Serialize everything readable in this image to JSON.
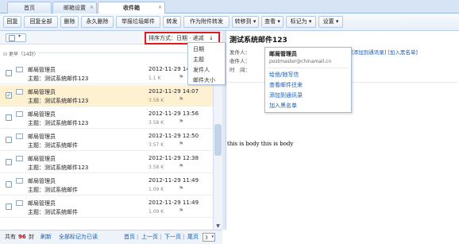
{
  "tabs": [
    {
      "label": "首页"
    },
    {
      "label": "邮箱设置"
    },
    {
      "label": "收件箱"
    }
  ],
  "toolbar": {
    "reply": "回复",
    "reply_all": "回复全部",
    "delete": "删除",
    "perm_delete": "永久删除",
    "report_spam": "举报垃圾邮件",
    "forward": "转发",
    "forward_attach": "作为附件转发",
    "move_to": "转移到",
    "view": "查看",
    "mark_as": "标记为",
    "settings": "设置"
  },
  "sort": {
    "label": "排序方式：日期 · 递减",
    "arrow": "↓",
    "options": [
      "日期",
      "主题",
      "发件人",
      "邮件大小"
    ]
  },
  "list": {
    "group_label": "更早（14封）",
    "messages": [
      {
        "from": "邮局管理员",
        "subject": "主题：测试系统邮件123",
        "date": "2012-11-29 14:07",
        "size": "1.1 K",
        "selected": false
      },
      {
        "from": "邮局管理员",
        "subject": "主题：测试系统邮件123",
        "date": "2012-11-29 14:07",
        "size": "3.58 K",
        "selected": true
      },
      {
        "from": "邮局管理员",
        "subject": "主题：测试系统邮件123",
        "date": "2012-11-29 13:56",
        "size": "3.58 K",
        "selected": false
      },
      {
        "from": "邮局管理员",
        "subject": "主题：测试系统邮件",
        "date": "2012-11-29 12:50",
        "size": "3.57 K",
        "selected": false
      },
      {
        "from": "邮局管理员",
        "subject": "主题：测试系统邮件123",
        "date": "2012-11-29 12:38",
        "size": "3.58 K",
        "selected": false
      },
      {
        "from": "邮局管理员",
        "subject": "主题：测试系统邮件",
        "date": "2012-11-29 11:49",
        "size": "1.09 K",
        "selected": false
      },
      {
        "from": "邮局管理员",
        "subject": "主题：测试系统邮件",
        "date": "2012-11-29 11:49",
        "size": "1.09 K",
        "selected": false
      }
    ]
  },
  "footer": {
    "total_prefix": "共有",
    "total_count": "96",
    "total_suffix": "封",
    "refresh": "刷新",
    "mark_all_read": "全部标记为已读",
    "first": "首页",
    "prev": "上一页",
    "next": "下一页",
    "last": "尾页",
    "page": "3"
  },
  "preview": {
    "title": "测试系统邮件123",
    "sender_label": "发件人：",
    "recipient_label": "收件人：",
    "time_label": "时　间：",
    "sender_tail": "cn> [添加到通讯录] [加入黑名单]",
    "body": "this is body this is body"
  },
  "contact_card": {
    "name": "邮局管理员",
    "email": "postmaster@chinamail.cn",
    "actions": [
      "给他/她写信",
      "查看邮件往来",
      "添加到通讯录",
      "加入黑名单"
    ]
  }
}
